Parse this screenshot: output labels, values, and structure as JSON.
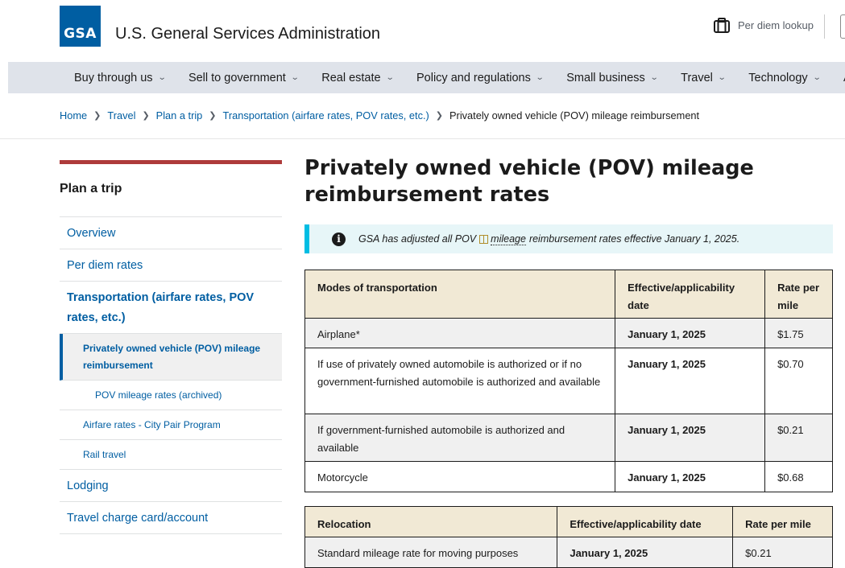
{
  "header": {
    "logo_text": "GSA",
    "agency_name": "U.S. General Services Administration",
    "perdiem_label": "Per diem lookup"
  },
  "nav": {
    "items": [
      {
        "label": "Buy through us"
      },
      {
        "label": "Sell to government"
      },
      {
        "label": "Real estate"
      },
      {
        "label": "Policy and regulations"
      },
      {
        "label": "Small business"
      },
      {
        "label": "Travel"
      },
      {
        "label": "Technology"
      },
      {
        "label": "Ab"
      }
    ]
  },
  "breadcrumb": {
    "items": [
      "Home",
      "Travel",
      "Plan a trip",
      "Transportation (airfare rates, POV rates, etc.)"
    ],
    "current": "Privately owned vehicle (POV) mileage reimbursement"
  },
  "sidebar": {
    "title": "Plan a trip",
    "items": [
      {
        "label": "Overview"
      },
      {
        "label": "Per diem rates"
      },
      {
        "label": "Transportation (airfare rates, POV rates, etc.)"
      },
      {
        "label": "Privately owned vehicle (POV) mileage reimbursement"
      },
      {
        "label": "POV mileage rates (archived)"
      },
      {
        "label": "Airfare rates - City Pair Program"
      },
      {
        "label": "Rail travel"
      },
      {
        "label": "Lodging"
      },
      {
        "label": "Travel charge card/account"
      }
    ]
  },
  "main": {
    "title": "Privately owned vehicle (POV) mileage reimbursement rates",
    "alert": {
      "prefix": "GSA has adjusted all POV",
      "term": "mileage",
      "suffix": "reimbursement rates effective January 1, 2025."
    },
    "table1": {
      "headers": [
        "Modes of transportation",
        "Effective/applicability date",
        "Rate per mile"
      ],
      "rows": [
        [
          "Airplane*",
          "January 1, 2025",
          "$1.75"
        ],
        [
          "If use of privately owned automobile is authorized or if no government-furnished automobile is authorized and available",
          "January 1, 2025",
          "$0.70"
        ],
        [
          "If government-furnished automobile is authorized and available",
          "January 1, 2025",
          "$0.21"
        ],
        [
          "Motorcycle",
          "January 1, 2025",
          "$0.68"
        ]
      ]
    },
    "table2": {
      "headers": [
        "Relocation",
        "Effective/applicability date",
        "Rate per mile"
      ],
      "rows": [
        [
          "Standard mileage rate for moving purposes",
          "January 1, 2025",
          "$0.21"
        ]
      ]
    }
  },
  "colors": {
    "primary": "#005ea2",
    "nav_bg": "#dfe3ea",
    "sidebar_accent": "#ae3b3b",
    "alert_border": "#00bde3",
    "table_header": "#f1e9d5"
  }
}
